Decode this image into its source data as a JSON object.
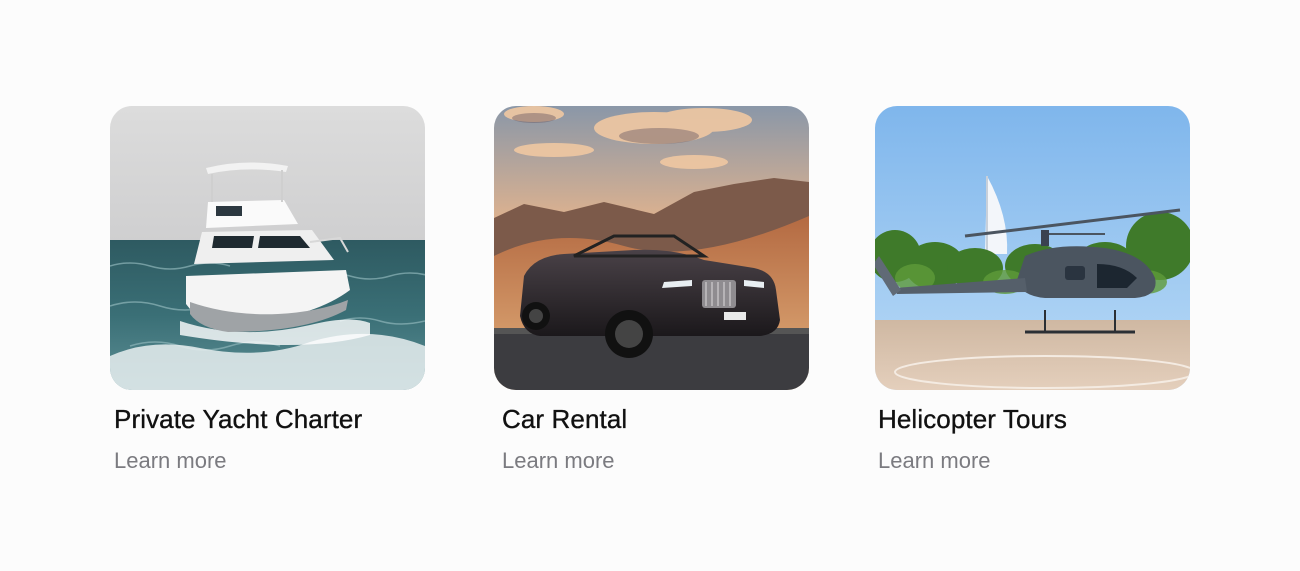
{
  "services": [
    {
      "title": "Private Yacht Charter",
      "link": "Learn more",
      "image": "yacht-photo"
    },
    {
      "title": "Car Rental",
      "link": "Learn more",
      "image": "convertible-car-photo"
    },
    {
      "title": "Helicopter Tours",
      "link": "Learn more",
      "image": "helicopter-photo"
    }
  ]
}
